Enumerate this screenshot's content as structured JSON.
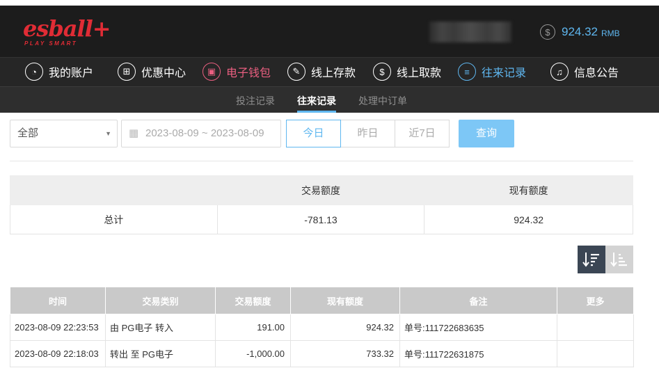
{
  "header": {
    "logo_text": "esball+",
    "logo_tag": "PLAY SMART",
    "balance_amount": "924.32",
    "balance_currency": "RMB",
    "coin_symbol": "$"
  },
  "nav": {
    "items": [
      {
        "label": "我的账户",
        "icon": "user-icon",
        "glyph": "◔"
      },
      {
        "label": "优惠中心",
        "icon": "gift-icon",
        "glyph": "⊞"
      },
      {
        "label": "电子钱包",
        "icon": "wallet-icon",
        "glyph": "▣"
      },
      {
        "label": "线上存款",
        "icon": "deposit-icon",
        "glyph": "✎"
      },
      {
        "label": "线上取款",
        "icon": "withdraw-icon",
        "glyph": "$"
      },
      {
        "label": "往来记录",
        "icon": "record-icon",
        "glyph": "≡"
      },
      {
        "label": "信息公告",
        "icon": "bell-icon",
        "glyph": "♫"
      }
    ]
  },
  "subnav": {
    "tabs": [
      {
        "label": "投注记录"
      },
      {
        "label": "往来记录"
      },
      {
        "label": "处理中订单"
      }
    ]
  },
  "filters": {
    "select_value": "全部",
    "date_range": "2023-08-09 ~ 2023-08-09",
    "range_buttons": [
      "今日",
      "昨日",
      "近7日"
    ],
    "query_label": "查询"
  },
  "summary": {
    "headers": [
      "",
      "交易额度",
      "现有额度"
    ],
    "row": [
      "总计",
      "-781.13",
      "924.32"
    ]
  },
  "records": {
    "headers": [
      "时间",
      "交易类别",
      "交易额度",
      "现有额度",
      "备注",
      "更多"
    ],
    "rows": [
      [
        "2023-08-09 22:23:53",
        "由 PG电子 转入",
        "191.00",
        "924.32",
        "单号:111722683635",
        ""
      ],
      [
        "2023-08-09 22:18:03",
        "转出 至 PG电子",
        "-1,000.00",
        "733.32",
        "单号:111722631875",
        ""
      ]
    ]
  },
  "colors": {
    "accent_blue": "#5fb7f0",
    "accent_red": "#ea5f80",
    "logo_red": "#e02c35",
    "query_btn": "#7dc7f6"
  }
}
